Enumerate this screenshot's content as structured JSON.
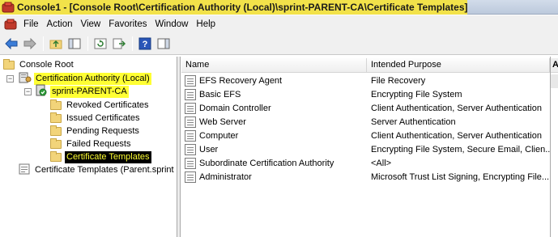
{
  "window": {
    "title": "Console1 - [Console Root\\Certification Authority (Local)\\sprint-PARENT-CA\\Certificate Templates]"
  },
  "menu": {
    "items": [
      "File",
      "Action",
      "View",
      "Favorites",
      "Window",
      "Help"
    ]
  },
  "toolbar": {
    "buttons": [
      "back-arrow-icon",
      "forward-arrow-icon",
      "up-folder-icon",
      "show-hide-tree-icon",
      "refresh-icon",
      "export-list-icon",
      "help-icon",
      "show-hide-action-pane-icon"
    ]
  },
  "tree": {
    "root": "Console Root",
    "ca_local": "Certification Authority (Local)",
    "ca_name": "sprint-PARENT-CA",
    "children": [
      "Revoked Certificates",
      "Issued Certificates",
      "Pending Requests",
      "Failed Requests",
      "Certificate Templates"
    ],
    "snapin": "Certificate Templates (Parent.sprint"
  },
  "list": {
    "columns": [
      "Name",
      "Intended Purpose"
    ],
    "rows": [
      {
        "name": "EFS Recovery Agent",
        "purpose": "File Recovery"
      },
      {
        "name": "Basic EFS",
        "purpose": "Encrypting File System"
      },
      {
        "name": "Domain Controller",
        "purpose": "Client Authentication, Server Authentication"
      },
      {
        "name": "Web Server",
        "purpose": "Server Authentication"
      },
      {
        "name": "Computer",
        "purpose": "Client Authentication, Server Authentication"
      },
      {
        "name": "User",
        "purpose": "Encrypting File System, Secure Email, Clien..."
      },
      {
        "name": "Subordinate Certification Authority",
        "purpose": "<All>"
      },
      {
        "name": "Administrator",
        "purpose": "Microsoft Trust List Signing, Encrypting File..."
      }
    ]
  },
  "actions_pane": {
    "header": "A"
  },
  "colors": {
    "highlight": "#ffff33",
    "title_highlight": "#f2e24a",
    "selected_bg": "#000000"
  }
}
